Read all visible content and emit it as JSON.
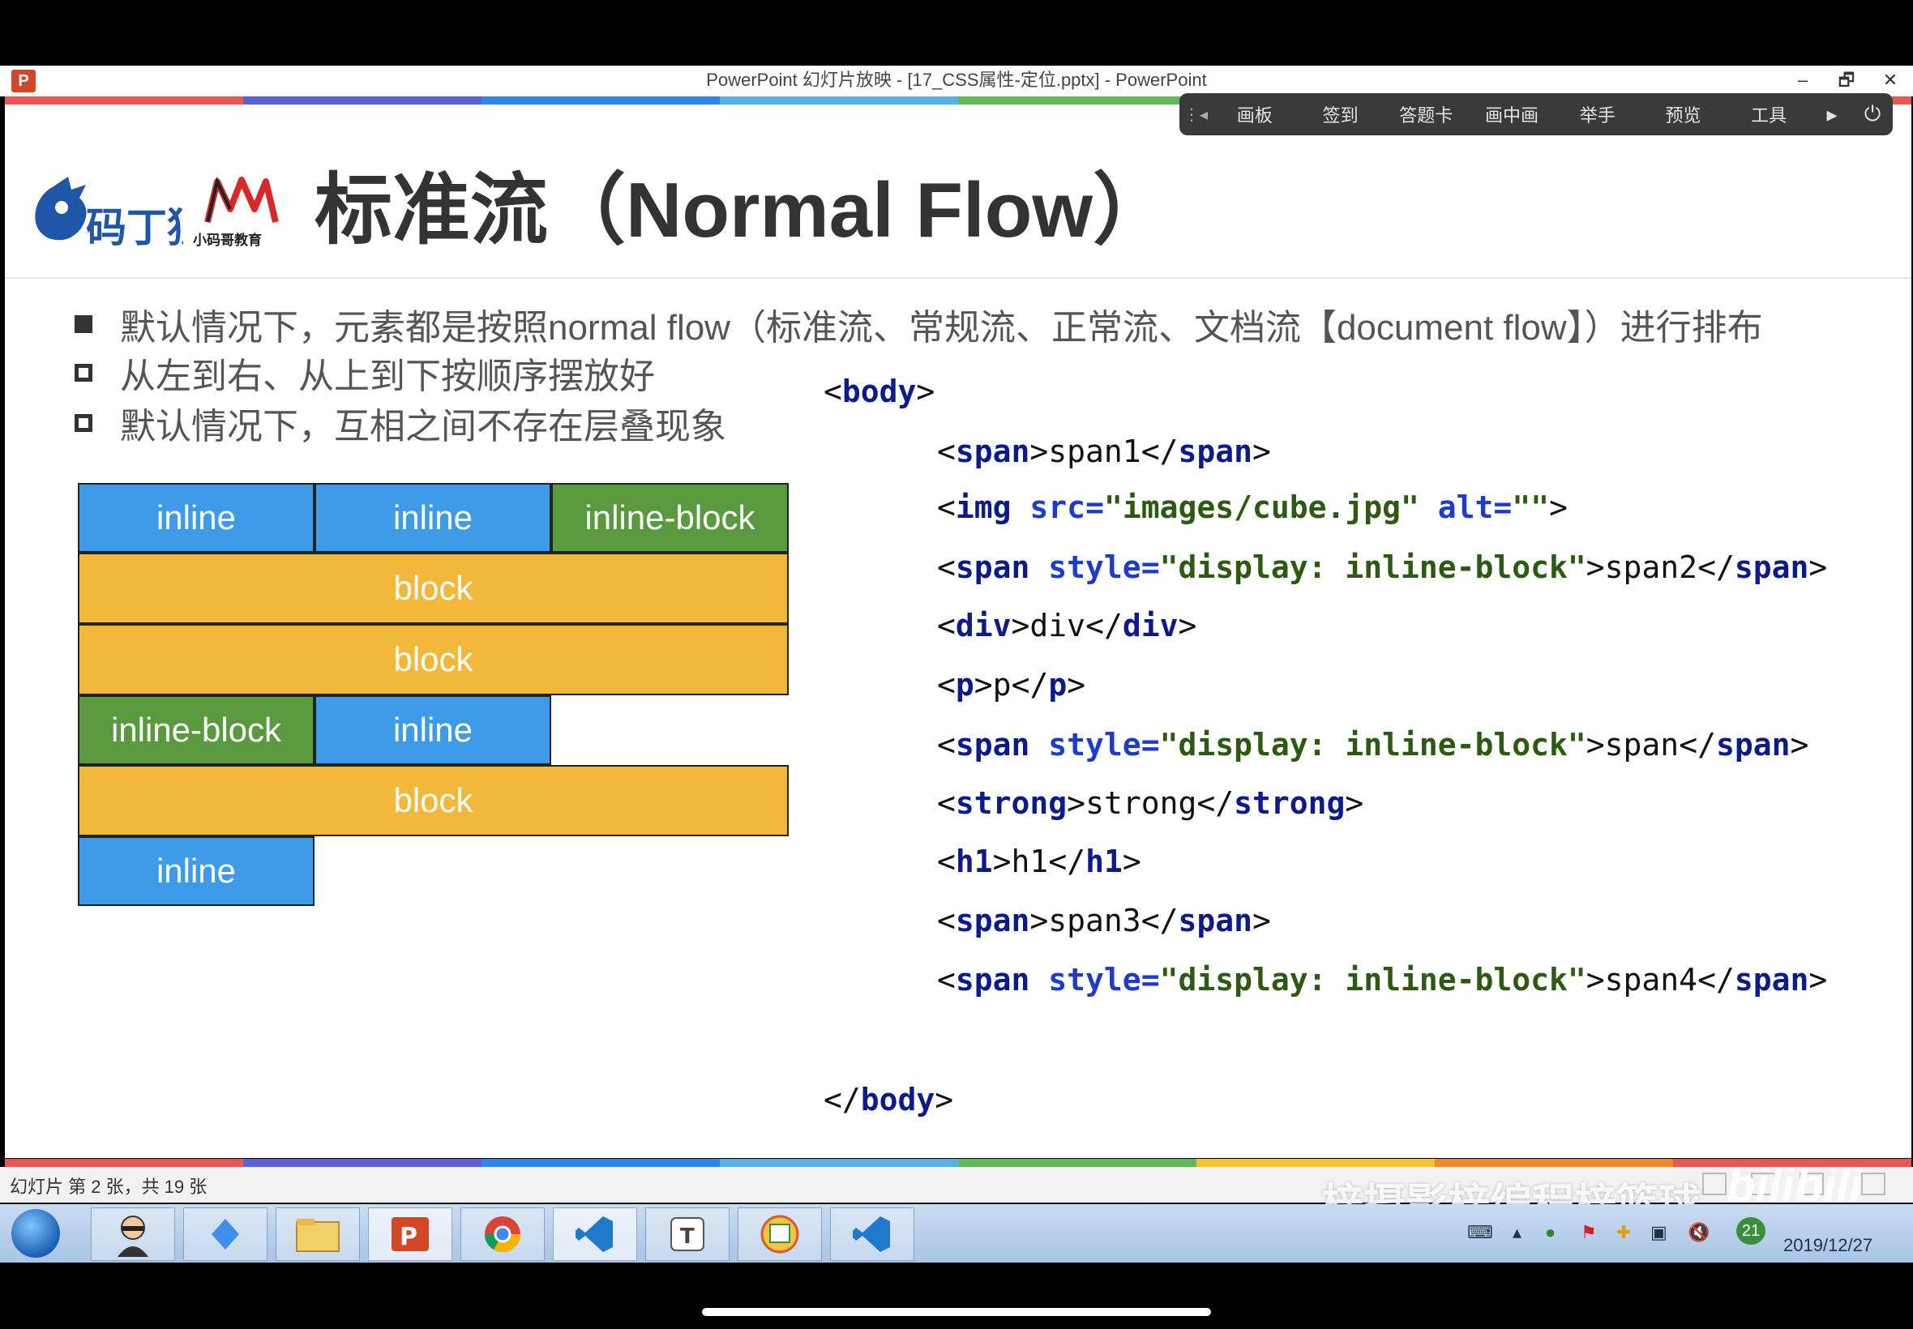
{
  "window": {
    "app_icon": "P",
    "title": "PowerPoint 幻灯片放映 - [17_CSS属性-定位.pptx] - PowerPoint",
    "controls": [
      "–",
      "🗗",
      "✕"
    ]
  },
  "toolbar": {
    "items": [
      "画板",
      "签到",
      "答题卡",
      "画中画",
      "举手",
      "预览",
      "工具"
    ]
  },
  "slide": {
    "logo_text": "码丁狼",
    "logo2_text": "小码哥教育",
    "title": "标准流（Normal Flow）",
    "bullets": [
      "默认情况下，元素都是按照normal flow（标准流、常规流、正常流、文档流【document flow】）进行排布",
      "从左到右、从上到下按顺序摆放好",
      "默认情况下，互相之间不存在层叠现象"
    ],
    "diagram": {
      "row1": [
        "inline",
        "inline",
        "inline-block"
      ],
      "row2": "block",
      "row3": "block",
      "row4": [
        "inline-block",
        "inline"
      ],
      "row5": "block",
      "row6": "inline"
    },
    "code": {
      "open_body": "body",
      "close_body": "body",
      "span1_tag": "span",
      "span1_text": "span1",
      "img_tag": "img",
      "img_src_attr": "src",
      "img_src_val": "\"images/cube.jpg\"",
      "img_alt_attr": "alt",
      "img_alt_val": "\"\"",
      "span2_tag": "span",
      "style_attr": "style",
      "style_val": "\"display: inline-block\"",
      "span2_text": "span2",
      "div_tag": "div",
      "div_text": "div",
      "p_tag": "p",
      "p_text": "p",
      "span_text": "span",
      "strong_tag": "strong",
      "strong_text": "strong",
      "h1_tag": "h1",
      "h1_text": "h1",
      "span3_text": "span3",
      "span4_text": "span4"
    }
  },
  "statusbar": {
    "text": "幻灯片 第 2 张，共 19 张",
    "watermark": "梓摄影梓编程梓篮球",
    "wm_logo": "bilibili"
  },
  "taskbar": {
    "apps": [
      "user-icon",
      "vscode-blue-icon",
      "file-explorer-icon",
      "powerpoint-icon",
      "chrome-icon",
      "vscode-icon",
      "typora-icon",
      "calendar-app-icon",
      "vscode-icon"
    ],
    "tray_badge": "21",
    "date": "2019/12/27"
  },
  "colors": {
    "inline": "#3e9be9",
    "inline_block": "#5a9a3f",
    "block": "#f2b83c",
    "stripe": [
      "#e85656",
      "#5c5fd6",
      "#2d86e8",
      "#55b3e3",
      "#63b95a",
      "#f2c531",
      "#f08a2d",
      "#e85656"
    ]
  }
}
